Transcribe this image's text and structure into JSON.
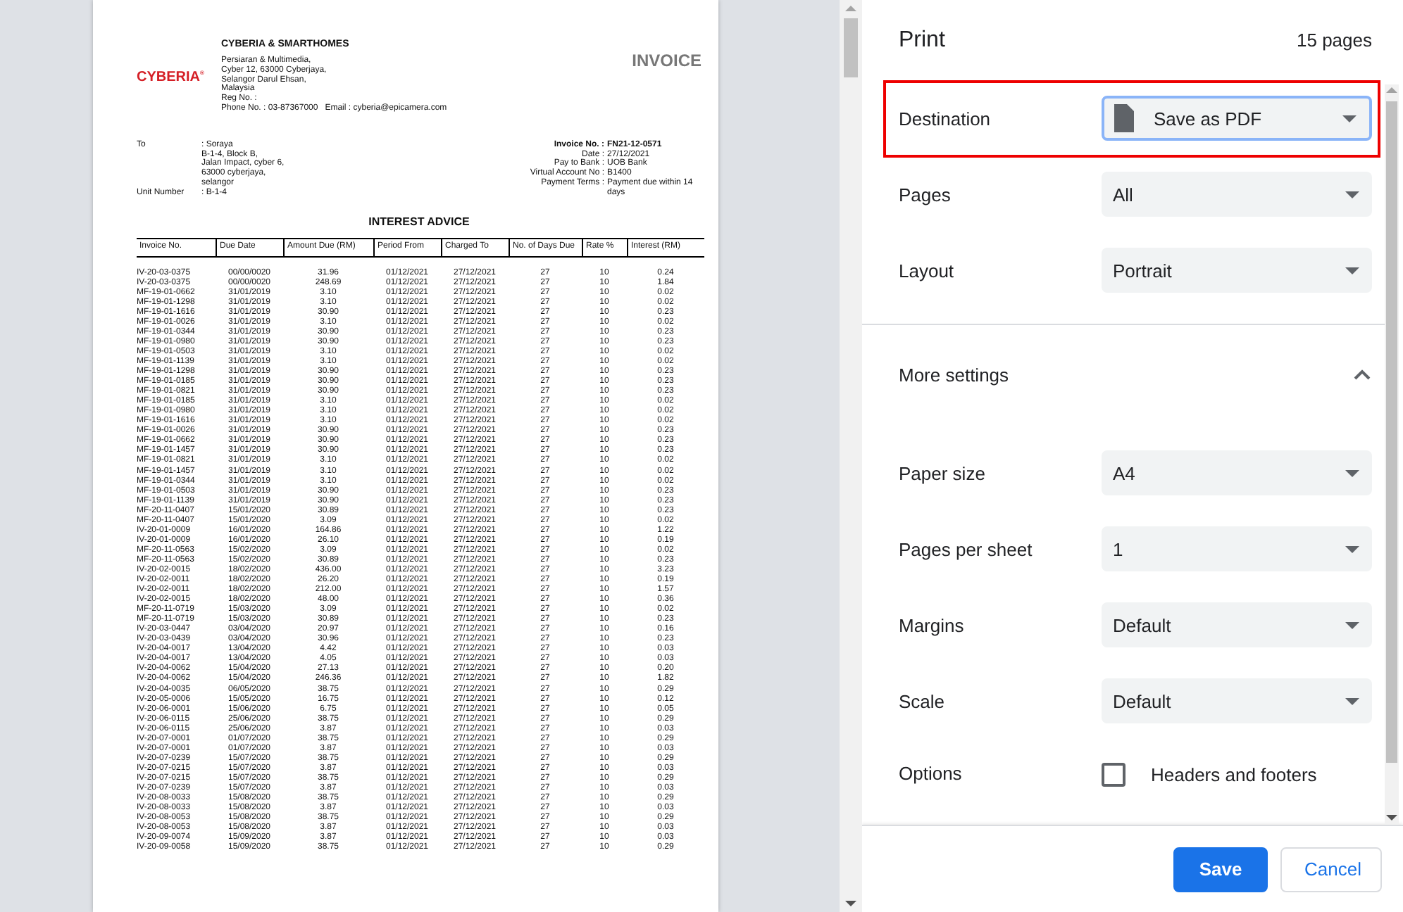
{
  "preview": {
    "company": {
      "logo": "CYBERIA$^{®}$",
      "name": "CYBERIA & SMARTHOMES",
      "address": [
        "Persiaran & Multimedia,",
        "Cyber 12, 63000 Cyberjaya,",
        "Selangor Darul Ehsan,",
        "Malaysia",
        "Reg No. :"
      ],
      "contact": "Phone No. : 03-87367000   Email : cyberia@epicamera.com"
    },
    "doc_title": "INVOICE",
    "recipient": {
      "to_label": "To",
      "to_lines": [
        ": Soraya",
        "B-1-4, Block B,",
        "Jalan Impact, cyber 6,",
        "63000 cyberjaya,",
        "selangor"
      ],
      "unit_label": "Unit Number",
      "unit_value": ": B-1-4"
    },
    "details": [
      {
        "label": "Invoice No. :",
        "value": "FN21-12-0571",
        "bold": true
      },
      {
        "label": "Date :",
        "value": "27/12/2021",
        "bold": false
      },
      {
        "label": "Pay to Bank :",
        "value": "UOB Bank",
        "bold": false
      },
      {
        "label": "Virtual Account No :",
        "value": "B1400",
        "bold": false
      },
      {
        "label": "Payment Terms :",
        "value": "Payment due within 14 days",
        "bold": false
      }
    ],
    "section_title": "INTEREST ADVICE",
    "table": {
      "columns": [
        "Invoice No.",
        "Due Date",
        "Amount Due (RM)",
        "Period From",
        "Charged To",
        "No. of Days Due",
        "Rate %",
        "Interest (RM)"
      ],
      "rows": [
        [
          "IV-20-03-0375",
          "00/00/0020",
          "31.96",
          "01/12/2021",
          "27/12/2021",
          "27",
          "10",
          "0.24"
        ],
        [
          "IV-20-03-0375",
          "00/00/0020",
          "248.69",
          "01/12/2021",
          "27/12/2021",
          "27",
          "10",
          "1.84"
        ],
        [
          "MF-19-01-0662",
          "31/01/2019",
          "3.10",
          "01/12/2021",
          "27/12/2021",
          "27",
          "10",
          "0.02"
        ],
        [
          "MF-19-01-1298",
          "31/01/2019",
          "3.10",
          "01/12/2021",
          "27/12/2021",
          "27",
          "10",
          "0.02"
        ],
        [
          "MF-19-01-1616",
          "31/01/2019",
          "30.90",
          "01/12/2021",
          "27/12/2021",
          "27",
          "10",
          "0.23"
        ],
        [
          "MF-19-01-0026",
          "31/01/2019",
          "3.10",
          "01/12/2021",
          "27/12/2021",
          "27",
          "10",
          "0.02"
        ],
        [
          "MF-19-01-0344",
          "31/01/2019",
          "30.90",
          "01/12/2021",
          "27/12/2021",
          "27",
          "10",
          "0.23"
        ],
        [
          "MF-19-01-0980",
          "31/01/2019",
          "30.90",
          "01/12/2021",
          "27/12/2021",
          "27",
          "10",
          "0.23"
        ],
        [
          "MF-19-01-0503",
          "31/01/2019",
          "3.10",
          "01/12/2021",
          "27/12/2021",
          "27",
          "10",
          "0.02"
        ],
        [
          "MF-19-01-1139",
          "31/01/2019",
          "3.10",
          "01/12/2021",
          "27/12/2021",
          "27",
          "10",
          "0.02"
        ],
        [
          "MF-19-01-1298",
          "31/01/2019",
          "30.90",
          "01/12/2021",
          "27/12/2021",
          "27",
          "10",
          "0.23"
        ],
        [
          "MF-19-01-0185",
          "31/01/2019",
          "30.90",
          "01/12/2021",
          "27/12/2021",
          "27",
          "10",
          "0.23"
        ],
        [
          "MF-19-01-0821",
          "31/01/2019",
          "30.90",
          "01/12/2021",
          "27/12/2021",
          "27",
          "10",
          "0.23"
        ],
        [
          "MF-19-01-0185",
          "31/01/2019",
          "3.10",
          "01/12/2021",
          "27/12/2021",
          "27",
          "10",
          "0.02"
        ],
        [
          "MF-19-01-0980",
          "31/01/2019",
          "3.10",
          "01/12/2021",
          "27/12/2021",
          "27",
          "10",
          "0.02"
        ],
        [
          "MF-19-01-1616",
          "31/01/2019",
          "3.10",
          "01/12/2021",
          "27/12/2021",
          "27",
          "10",
          "0.02"
        ],
        [
          "MF-19-01-0026",
          "31/01/2019",
          "30.90",
          "01/12/2021",
          "27/12/2021",
          "27",
          "10",
          "0.23"
        ],
        [
          "MF-19-01-0662",
          "31/01/2019",
          "30.90",
          "01/12/2021",
          "27/12/2021",
          "27",
          "10",
          "0.23"
        ],
        [
          "MF-19-01-1457",
          "31/01/2019",
          "30.90",
          "01/12/2021",
          "27/12/2021",
          "27",
          "10",
          "0.23"
        ],
        [
          "MF-19-01-0821",
          "31/01/2019",
          "3.10",
          "01/12/2021",
          "27/12/2021",
          "27",
          "10",
          "0.02"
        ],
        [
          "MF-19-01-1457",
          "31/01/2019",
          "3.10",
          "01/12/2021",
          "27/12/2021",
          "27",
          "10",
          "0.02"
        ],
        [
          "MF-19-01-0344",
          "31/01/2019",
          "3.10",
          "01/12/2021",
          "27/12/2021",
          "27",
          "10",
          "0.02"
        ],
        [
          "MF-19-01-0503",
          "31/01/2019",
          "30.90",
          "01/12/2021",
          "27/12/2021",
          "27",
          "10",
          "0.23"
        ],
        [
          "MF-19-01-1139",
          "31/01/2019",
          "30.90",
          "01/12/2021",
          "27/12/2021",
          "27",
          "10",
          "0.23"
        ],
        [
          "MF-20-11-0407",
          "15/01/2020",
          "30.89",
          "01/12/2021",
          "27/12/2021",
          "27",
          "10",
          "0.23"
        ],
        [
          "MF-20-11-0407",
          "15/01/2020",
          "3.09",
          "01/12/2021",
          "27/12/2021",
          "27",
          "10",
          "0.02"
        ],
        [
          "IV-20-01-0009",
          "16/01/2020",
          "164.86",
          "01/12/2021",
          "27/12/2021",
          "27",
          "10",
          "1.22"
        ],
        [
          "IV-20-01-0009",
          "16/01/2020",
          "26.10",
          "01/12/2021",
          "27/12/2021",
          "27",
          "10",
          "0.19"
        ],
        [
          "MF-20-11-0563",
          "15/02/2020",
          "3.09",
          "01/12/2021",
          "27/12/2021",
          "27",
          "10",
          "0.02"
        ],
        [
          "MF-20-11-0563",
          "15/02/2020",
          "30.89",
          "01/12/2021",
          "27/12/2021",
          "27",
          "10",
          "0.23"
        ],
        [
          "IV-20-02-0015",
          "18/02/2020",
          "436.00",
          "01/12/2021",
          "27/12/2021",
          "27",
          "10",
          "3.23"
        ],
        [
          "IV-20-02-0011",
          "18/02/2020",
          "26.20",
          "01/12/2021",
          "27/12/2021",
          "27",
          "10",
          "0.19"
        ],
        [
          "IV-20-02-0011",
          "18/02/2020",
          "212.00",
          "01/12/2021",
          "27/12/2021",
          "27",
          "10",
          "1.57"
        ],
        [
          "IV-20-02-0015",
          "18/02/2020",
          "48.00",
          "01/12/2021",
          "27/12/2021",
          "27",
          "10",
          "0.36"
        ],
        [
          "MF-20-11-0719",
          "15/03/2020",
          "3.09",
          "01/12/2021",
          "27/12/2021",
          "27",
          "10",
          "0.02"
        ],
        [
          "MF-20-11-0719",
          "15/03/2020",
          "30.89",
          "01/12/2021",
          "27/12/2021",
          "27",
          "10",
          "0.23"
        ],
        [
          "IV-20-03-0447",
          "03/04/2020",
          "20.97",
          "01/12/2021",
          "27/12/2021",
          "27",
          "10",
          "0.16"
        ],
        [
          "IV-20-03-0439",
          "03/04/2020",
          "30.96",
          "01/12/2021",
          "27/12/2021",
          "27",
          "10",
          "0.23"
        ],
        [
          "IV-20-04-0017",
          "13/04/2020",
          "4.42",
          "01/12/2021",
          "27/12/2021",
          "27",
          "10",
          "0.03"
        ],
        [
          "IV-20-04-0017",
          "13/04/2020",
          "4.05",
          "01/12/2021",
          "27/12/2021",
          "27",
          "10",
          "0.03"
        ],
        [
          "IV-20-04-0062",
          "15/04/2020",
          "27.13",
          "01/12/2021",
          "27/12/2021",
          "27",
          "10",
          "0.20"
        ],
        [
          "IV-20-04-0062",
          "15/04/2020",
          "246.36",
          "01/12/2021",
          "27/12/2021",
          "27",
          "10",
          "1.82"
        ],
        [
          "IV-20-04-0035",
          "06/05/2020",
          "38.75",
          "01/12/2021",
          "27/12/2021",
          "27",
          "10",
          "0.29"
        ],
        [
          "IV-20-05-0006",
          "15/05/2020",
          "16.75",
          "01/12/2021",
          "27/12/2021",
          "27",
          "10",
          "0.12"
        ],
        [
          "IV-20-06-0001",
          "15/06/2020",
          "6.75",
          "01/12/2021",
          "27/12/2021",
          "27",
          "10",
          "0.05"
        ],
        [
          "IV-20-06-0115",
          "25/06/2020",
          "38.75",
          "01/12/2021",
          "27/12/2021",
          "27",
          "10",
          "0.29"
        ],
        [
          "IV-20-06-0115",
          "25/06/2020",
          "3.87",
          "01/12/2021",
          "27/12/2021",
          "27",
          "10",
          "0.03"
        ],
        [
          "IV-20-07-0001",
          "01/07/2020",
          "38.75",
          "01/12/2021",
          "27/12/2021",
          "27",
          "10",
          "0.29"
        ],
        [
          "IV-20-07-0001",
          "01/07/2020",
          "3.87",
          "01/12/2021",
          "27/12/2021",
          "27",
          "10",
          "0.03"
        ],
        [
          "IV-20-07-0239",
          "15/07/2020",
          "38.75",
          "01/12/2021",
          "27/12/2021",
          "27",
          "10",
          "0.29"
        ],
        [
          "IV-20-07-0215",
          "15/07/2020",
          "3.87",
          "01/12/2021",
          "27/12/2021",
          "27",
          "10",
          "0.03"
        ],
        [
          "IV-20-07-0215",
          "15/07/2020",
          "38.75",
          "01/12/2021",
          "27/12/2021",
          "27",
          "10",
          "0.29"
        ],
        [
          "IV-20-07-0239",
          "15/07/2020",
          "3.87",
          "01/12/2021",
          "27/12/2021",
          "27",
          "10",
          "0.03"
        ],
        [
          "IV-20-08-0033",
          "15/08/2020",
          "38.75",
          "01/12/2021",
          "27/12/2021",
          "27",
          "10",
          "0.29"
        ],
        [
          "IV-20-08-0033",
          "15/08/2020",
          "3.87",
          "01/12/2021",
          "27/12/2021",
          "27",
          "10",
          "0.03"
        ],
        [
          "IV-20-08-0053",
          "15/08/2020",
          "38.75",
          "01/12/2021",
          "27/12/2021",
          "27",
          "10",
          "0.29"
        ],
        [
          "IV-20-08-0053",
          "15/08/2020",
          "3.87",
          "01/12/2021",
          "27/12/2021",
          "27",
          "10",
          "0.03"
        ],
        [
          "IV-20-09-0074",
          "15/09/2020",
          "3.87",
          "01/12/2021",
          "27/12/2021",
          "27",
          "10",
          "0.03"
        ],
        [
          "IV-20-09-0058",
          "15/09/2020",
          "38.75",
          "01/12/2021",
          "27/12/2021",
          "27",
          "10",
          "0.29"
        ]
      ]
    }
  },
  "print_panel": {
    "title": "Print",
    "page_count": "15 pages",
    "settings": [
      {
        "kind": "destination",
        "label": "Destination",
        "value": "Save as PDF",
        "focused": true,
        "highlighted": true
      },
      {
        "kind": "select",
        "label": "Pages",
        "value": "All",
        "focused": false,
        "highlighted": false
      },
      {
        "kind": "select",
        "label": "Layout",
        "value": "Portrait",
        "focused": false,
        "highlighted": false
      },
      {
        "kind": "section",
        "label": "More settings",
        "expanded": true
      },
      {
        "kind": "select",
        "label": "Paper size",
        "value": "A4",
        "focused": false,
        "highlighted": false
      },
      {
        "kind": "select",
        "label": "Pages per sheet",
        "value": "1",
        "focused": false,
        "highlighted": false
      },
      {
        "kind": "select",
        "label": "Margins",
        "value": "Default",
        "focused": false,
        "highlighted": false
      },
      {
        "kind": "select",
        "label": "Scale",
        "value": "Default",
        "focused": false,
        "highlighted": false
      },
      {
        "kind": "checkboxes",
        "label": "Options",
        "options": [
          {
            "label": "Headers and footers",
            "checked": false
          }
        ]
      }
    ],
    "buttons": [
      {
        "label": "Save",
        "primary": true
      },
      {
        "label": "Cancel",
        "primary": false
      }
    ]
  }
}
